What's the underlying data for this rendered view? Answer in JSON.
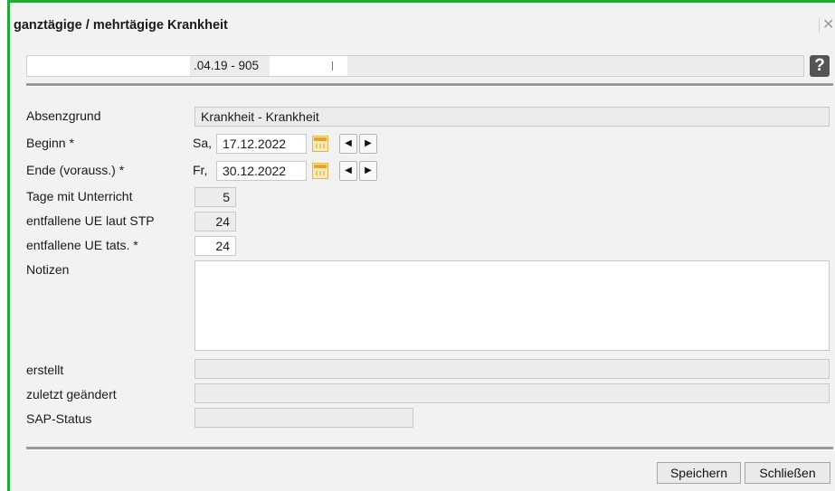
{
  "dialog": {
    "title": "ganztägige / mehrtägige Krankheit",
    "close_icon": "close-icon",
    "help_icon": "?"
  },
  "id_bar": {
    "text": ".04.19     - 905"
  },
  "form": {
    "absenzgrund": {
      "label": "Absenzgrund",
      "value": "Krankheit - Krankheit"
    },
    "beginn": {
      "label": "Beginn *",
      "weekday": "Sa,",
      "date": "17.12.2022"
    },
    "ende": {
      "label": "Ende (vorauss.) *",
      "weekday": "Fr,",
      "date": "30.12.2022"
    },
    "tage": {
      "label": "Tage mit Unterricht",
      "value": "5"
    },
    "ue_stp": {
      "label": "entfallene UE laut STP",
      "value": "24"
    },
    "ue_tats": {
      "label": "entfallene UE tats. *",
      "value": "24"
    },
    "notizen": {
      "label": "Notizen",
      "value": ""
    },
    "erstellt": {
      "label": "erstellt",
      "value": ""
    },
    "geaendert": {
      "label": "zuletzt geändert",
      "value": ""
    },
    "sap": {
      "label": "SAP-Status",
      "value": ""
    }
  },
  "buttons": {
    "save": "Speichern",
    "close": "Schließen"
  },
  "colors": {
    "frame_accent": "#22a83a",
    "background": "#f2f2f2"
  }
}
